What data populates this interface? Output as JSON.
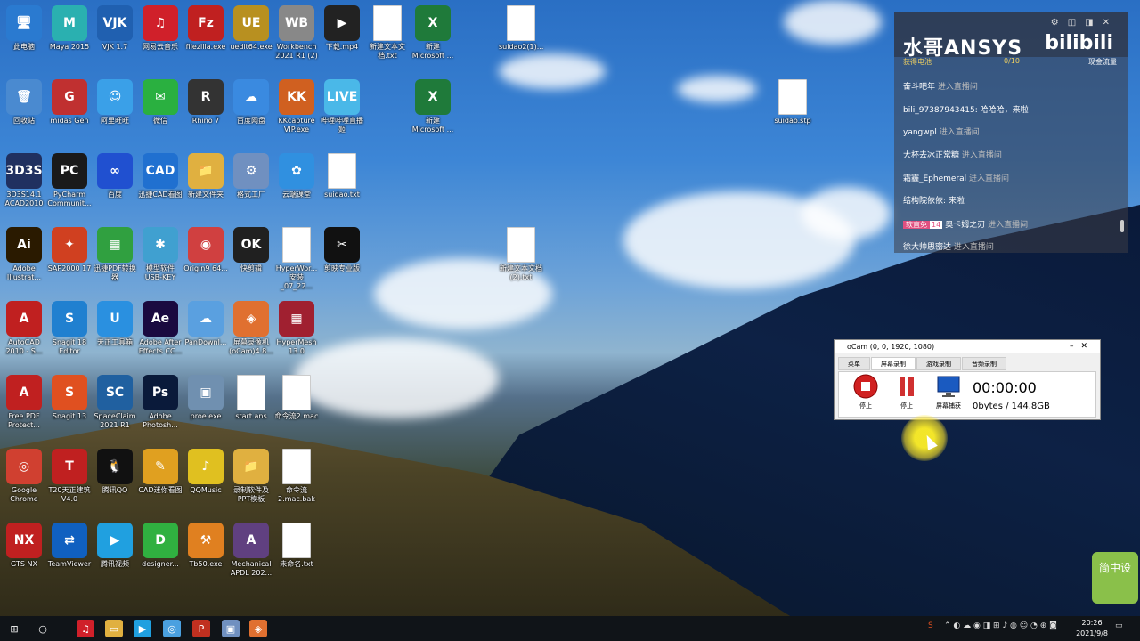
{
  "desktop": {
    "icons": [
      {
        "label": "此电脑",
        "glyph": "🖥",
        "color": "#2a7ad0"
      },
      {
        "label": "Maya 2015",
        "glyph": "M",
        "color": "#2ab0b0"
      },
      {
        "label": "VJK 1.7",
        "glyph": "VJK",
        "color": "#2060b0"
      },
      {
        "label": "网易云音乐",
        "glyph": "♫",
        "color": "#d0202a"
      },
      {
        "label": "filezilla.exe",
        "glyph": "Fz",
        "color": "#c02020"
      },
      {
        "label": "uedit64.exe",
        "glyph": "UE",
        "color": "#b89020"
      },
      {
        "label": "Workbench 2021 R1 (2)",
        "glyph": "WB",
        "color": "#888888"
      },
      {
        "label": "下载.mp4",
        "glyph": "▶",
        "color": "#222222"
      },
      {
        "label": "新建文本文档.txt",
        "glyph": "",
        "color": "doc"
      },
      {
        "label": "新建 Microsoft ...",
        "glyph": "X",
        "color": "#1f7a3a"
      },
      {
        "label": "suidao2(1)...",
        "glyph": "",
        "color": "doc"
      },
      {
        "label": "回收站",
        "glyph": "🗑",
        "color": "#4a8ad0"
      },
      {
        "label": "midas Gen",
        "glyph": "G",
        "color": "#c03030"
      },
      {
        "label": "阿里旺旺",
        "glyph": "☺",
        "color": "#3aa0e8"
      },
      {
        "label": "微信",
        "glyph": "✉",
        "color": "#2ab040"
      },
      {
        "label": "Rhino 7",
        "glyph": "R",
        "color": "#333333"
      },
      {
        "label": "百度网盘",
        "glyph": "☁",
        "color": "#3a8ae0"
      },
      {
        "label": "KKcapture VIP.exe",
        "glyph": "KK",
        "color": "#d06020"
      },
      {
        "label": "哔哩哔哩直播姬",
        "glyph": "LIVE",
        "color": "#4ab8e8"
      },
      {
        "label": "新建 Microsoft ...",
        "glyph": "X",
        "color": "#1f7a3a"
      },
      {
        "label": "suidao.stp",
        "glyph": "",
        "color": "doc"
      },
      {
        "label": "3D3S14.1 ACAD2010",
        "glyph": "3D3S",
        "color": "#203060"
      },
      {
        "label": "PyCharm Communit...",
        "glyph": "PC",
        "color": "#1a1a1a"
      },
      {
        "label": "百度",
        "glyph": "∞",
        "color": "#2050d0"
      },
      {
        "label": "迅捷CAD看图",
        "glyph": "CAD",
        "color": "#2070d0"
      },
      {
        "label": "新建文件夹",
        "glyph": "📁",
        "color": "#e0b040"
      },
      {
        "label": "格式工厂",
        "glyph": "⚙",
        "color": "#7090c0"
      },
      {
        "label": "云端课堂",
        "glyph": "✿",
        "color": "#3090e0"
      },
      {
        "label": "suidao.txt",
        "glyph": "",
        "color": "doc"
      },
      {
        "label": "Adobe Illustrat...",
        "glyph": "Ai",
        "color": "#2a1a00"
      },
      {
        "label": "SAP2000 17",
        "glyph": "✦",
        "color": "#d04020"
      },
      {
        "label": "迅捷PDF转换器",
        "glyph": "▦",
        "color": "#30a040"
      },
      {
        "label": "模型软件 USB-KEY",
        "glyph": "✱",
        "color": "#40a0d0"
      },
      {
        "label": "Origin9 64...",
        "glyph": "◉",
        "color": "#d04040"
      },
      {
        "label": "快剪辑",
        "glyph": "OK",
        "color": "#202020"
      },
      {
        "label": "HyperWor... 安装_07_22...",
        "glyph": "",
        "color": "doc"
      },
      {
        "label": "剪映专业版",
        "glyph": "✂",
        "color": "#111111"
      },
      {
        "label": "新建文本文档 (2).txt",
        "glyph": "",
        "color": "doc"
      },
      {
        "label": "AutoCAD 2010 - S...",
        "glyph": "A",
        "color": "#c02020"
      },
      {
        "label": "Snagit 18 Editor",
        "glyph": "S",
        "color": "#2080d0"
      },
      {
        "label": "天正工具箱",
        "glyph": "U",
        "color": "#2a90e0"
      },
      {
        "label": "Adobe After Effects CC...",
        "glyph": "Ae",
        "color": "#1a0a40"
      },
      {
        "label": "PanDownl...",
        "glyph": "☁",
        "color": "#5aa0e0"
      },
      {
        "label": "屏幕录像机 (oCam)4.8...",
        "glyph": "◈",
        "color": "#e07030"
      },
      {
        "label": "HyperMesh 13.0",
        "glyph": "▦",
        "color": "#a02030"
      },
      {
        "label": "Free PDF Protect...",
        "glyph": "A",
        "color": "#c02020"
      },
      {
        "label": "Snagit 13",
        "glyph": "S",
        "color": "#e05020"
      },
      {
        "label": "SpaceClaim 2021 R1",
        "glyph": "SC",
        "color": "#2060a0"
      },
      {
        "label": "Adobe Photosh...",
        "glyph": "Ps",
        "color": "#0a1a3a"
      },
      {
        "label": "proe.exe",
        "glyph": "▣",
        "color": "#7090b0"
      },
      {
        "label": "start.ans",
        "glyph": "",
        "color": "doc"
      },
      {
        "label": "命令流2.mac",
        "glyph": "",
        "color": "doc"
      },
      {
        "label": "Google Chrome",
        "glyph": "◎",
        "color": "#d04030"
      },
      {
        "label": "T20天正建筑 V4.0",
        "glyph": "T",
        "color": "#c02020"
      },
      {
        "label": "腾讯QQ",
        "glyph": "🐧",
        "color": "#111111"
      },
      {
        "label": "CAD迷你看图",
        "glyph": "✎",
        "color": "#e0a020"
      },
      {
        "label": "QQMusic",
        "glyph": "♪",
        "color": "#e0c020"
      },
      {
        "label": "录制软件及PPT模板",
        "glyph": "📁",
        "color": "#e0b040"
      },
      {
        "label": "命令流 2.mac.bak",
        "glyph": "",
        "color": "doc"
      },
      {
        "label": "GTS NX",
        "glyph": "NX",
        "color": "#c02020"
      },
      {
        "label": "TeamViewer",
        "glyph": "⇄",
        "color": "#1060c0"
      },
      {
        "label": "腾讯视频",
        "glyph": "▶",
        "color": "#20a0e0"
      },
      {
        "label": "designer...",
        "glyph": "D",
        "color": "#30b040"
      },
      {
        "label": "Tb50.exe",
        "glyph": "⚒",
        "color": "#e08020"
      },
      {
        "label": "Mechanical APDL 202...",
        "glyph": "A",
        "color": "#604080"
      },
      {
        "label": "未命名.txt",
        "glyph": "",
        "color": "doc"
      }
    ]
  },
  "bilibili": {
    "title": "水哥ANSYS",
    "logo": "bilibili",
    "gift": "获得电池",
    "score": "0/10",
    "cash": "现金流量",
    "messages": [
      {
        "user": "奋斗吧年",
        "text": "进入直播间",
        "action": true
      },
      {
        "user": "bili_97387943415:",
        "text": "哈哈哈，来啦",
        "action": false
      },
      {
        "user": "yangwpl",
        "text": "进入直播间",
        "action": true
      },
      {
        "user": "大杯去冰正常糖",
        "text": "进入直播间",
        "action": true
      },
      {
        "user": "霜霾_Ephemeral",
        "text": "进入直播间",
        "action": true
      },
      {
        "user": "结构院依依:",
        "text": "来啦",
        "action": false
      },
      {
        "user": "奥卡姆之刃",
        "text": "进入直播间",
        "action": true,
        "badge": "软直免",
        "lv": "14"
      },
      {
        "user": "徐大帅思密达",
        "text": "进入直播间",
        "action": true
      }
    ]
  },
  "ocam": {
    "title": "oCam (0, 0, 1920, 1080)",
    "tabs": [
      "菜单",
      "屏幕录制",
      "游戏录制",
      "音频录制"
    ],
    "active_tab": 1,
    "stop_label": "停止",
    "pause_label": "停止",
    "capture_label": "屏幕捕获",
    "time": "00:00:00",
    "size": "0bytes / 144.8GB"
  },
  "watermark": "简中设",
  "taskbar": {
    "time": "20:26",
    "date": "2021/9/8"
  }
}
